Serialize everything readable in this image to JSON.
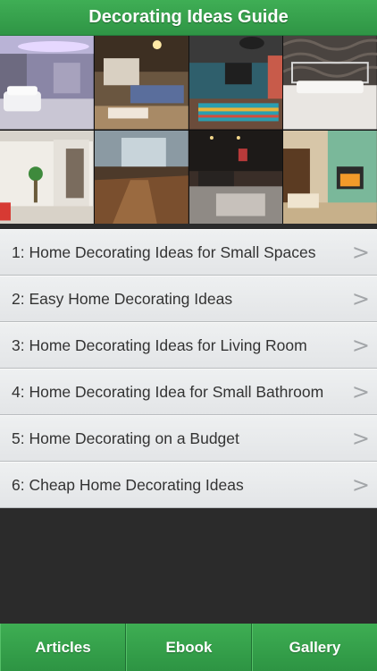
{
  "header": {
    "title": "Decorating Ideas Guide"
  },
  "articles": [
    "1: Home Decorating Ideas for Small Spaces",
    "2: Easy Home Decorating Ideas",
    "3: Home Decorating Ideas for Living Room",
    "4: Home Decorating Idea for Small Bathroom",
    "5: Home Decorating on a Budget",
    "6: Cheap Home Decorating Ideas"
  ],
  "chevron": ">",
  "tabs": [
    "Articles",
    "Ebook",
    "Gallery"
  ],
  "colors": {
    "brand_green": "#34a04b",
    "list_bg": "#e8eaec",
    "page_bg": "#2b2b2b"
  }
}
